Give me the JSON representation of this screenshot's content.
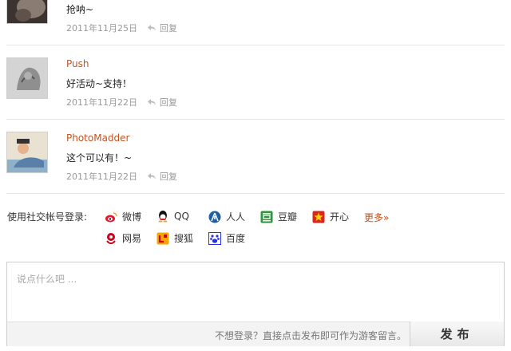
{
  "comments": [
    {
      "author": "",
      "text": "抢呐~",
      "date": "2011年11月25日",
      "reply": "回复"
    },
    {
      "author": "Push",
      "text": "好活动~支持！",
      "date": "2011年11月22日",
      "reply": "回复"
    },
    {
      "author": "PhotoMadder",
      "text": "这个可以有！~",
      "date": "2011年11月22日",
      "reply": "回复"
    }
  ],
  "social": {
    "label": "使用社交帐号登录:",
    "networks": [
      {
        "name": "微博",
        "icon": "weibo-icon",
        "color": "#e6162d"
      },
      {
        "name": "QQ",
        "icon": "qq-icon",
        "color": "#111111"
      },
      {
        "name": "人人",
        "icon": "renren-icon",
        "color": "#1f5fa7"
      },
      {
        "name": "豆瓣",
        "icon": "douban-icon",
        "color": "#2e963d"
      },
      {
        "name": "开心",
        "icon": "kaixin-icon",
        "color": "#d9261c"
      },
      {
        "name": "网易",
        "icon": "netease-icon",
        "color": "#d0021b"
      },
      {
        "name": "搜狐",
        "icon": "sohu-icon",
        "color": "#f7a600"
      },
      {
        "name": "百度",
        "icon": "baidu-icon",
        "color": "#2932e1"
      }
    ],
    "more": "更多»"
  },
  "compose": {
    "placeholder": "说点什么吧 ...",
    "hint": "不想登录？直接点击发布即可作为游客留言。",
    "post_label": "发布"
  },
  "colors": {
    "accent": "#c8511b",
    "muted": "#999999"
  }
}
